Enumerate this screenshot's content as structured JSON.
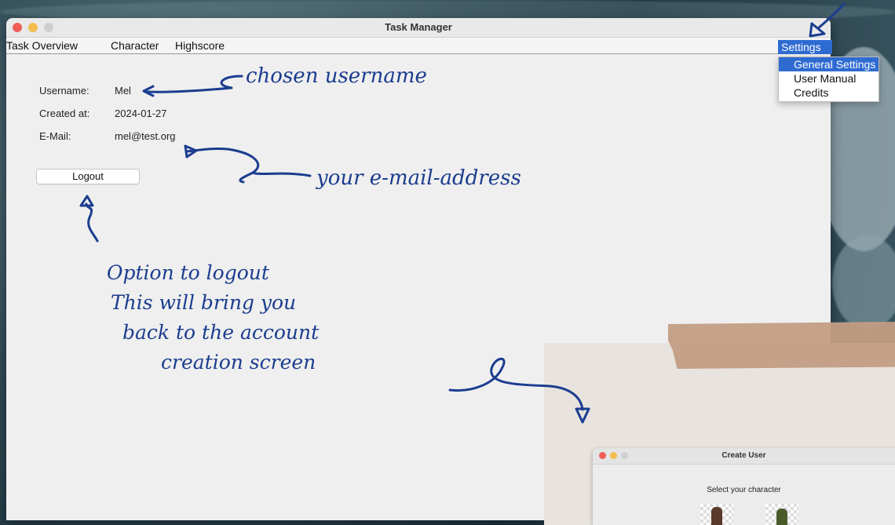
{
  "window": {
    "title": "Task Manager"
  },
  "menubar": {
    "items": [
      "Task Overview",
      "Character",
      "Highscore"
    ],
    "settings": "Settings"
  },
  "settings_menu": {
    "items": [
      "General Settings",
      "User Manual",
      "Credits"
    ],
    "active_index": 0
  },
  "profile": {
    "username_label": "Username:",
    "username_value": "Mel",
    "created_label": "Created at:",
    "created_value": "2024-01-27",
    "email_label": "E-Mail:",
    "email_value": "mel@test.org",
    "logout_label": "Logout"
  },
  "annotations": {
    "username_note": "chosen username",
    "email_note": "your e-mail-address",
    "logout_note_lines": [
      "Option to logout",
      "This will bring you",
      "back to the account",
      "creation screen"
    ]
  },
  "mini_window": {
    "title": "Create User",
    "subtitle": "Select your character"
  },
  "colors": {
    "accent": "#2e6bd1",
    "ink": "#1b3d8f",
    "tape": "#c29d83",
    "paper": "#e8e3df"
  }
}
